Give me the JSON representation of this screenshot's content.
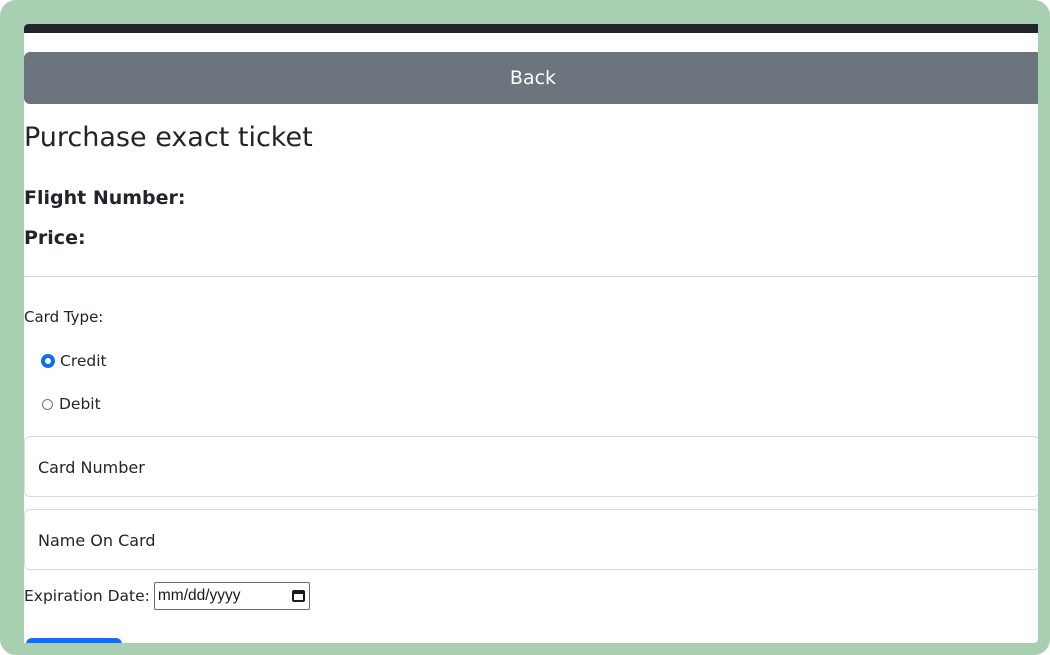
{
  "nav": {
    "back_label": "Back"
  },
  "header": {
    "title": "Purchase exact ticket"
  },
  "ticket": {
    "flight_number_label": "Flight Number:",
    "price_label": "Price:"
  },
  "form": {
    "card_type_label": "Card Type:",
    "card_type_options": [
      {
        "label": "Credit",
        "checked": true
      },
      {
        "label": "Debit",
        "checked": false
      }
    ],
    "card_number_placeholder": "Card Number",
    "name_on_card_placeholder": "Name On Card",
    "expiration_label": "Expiration Date:",
    "expiration_placeholder": "mm/dd/yyyy"
  },
  "colors": {
    "frame": "#a8cfb1",
    "topbar": "#212529",
    "back_button": "#6c757d",
    "primary": "#0d6efd"
  }
}
